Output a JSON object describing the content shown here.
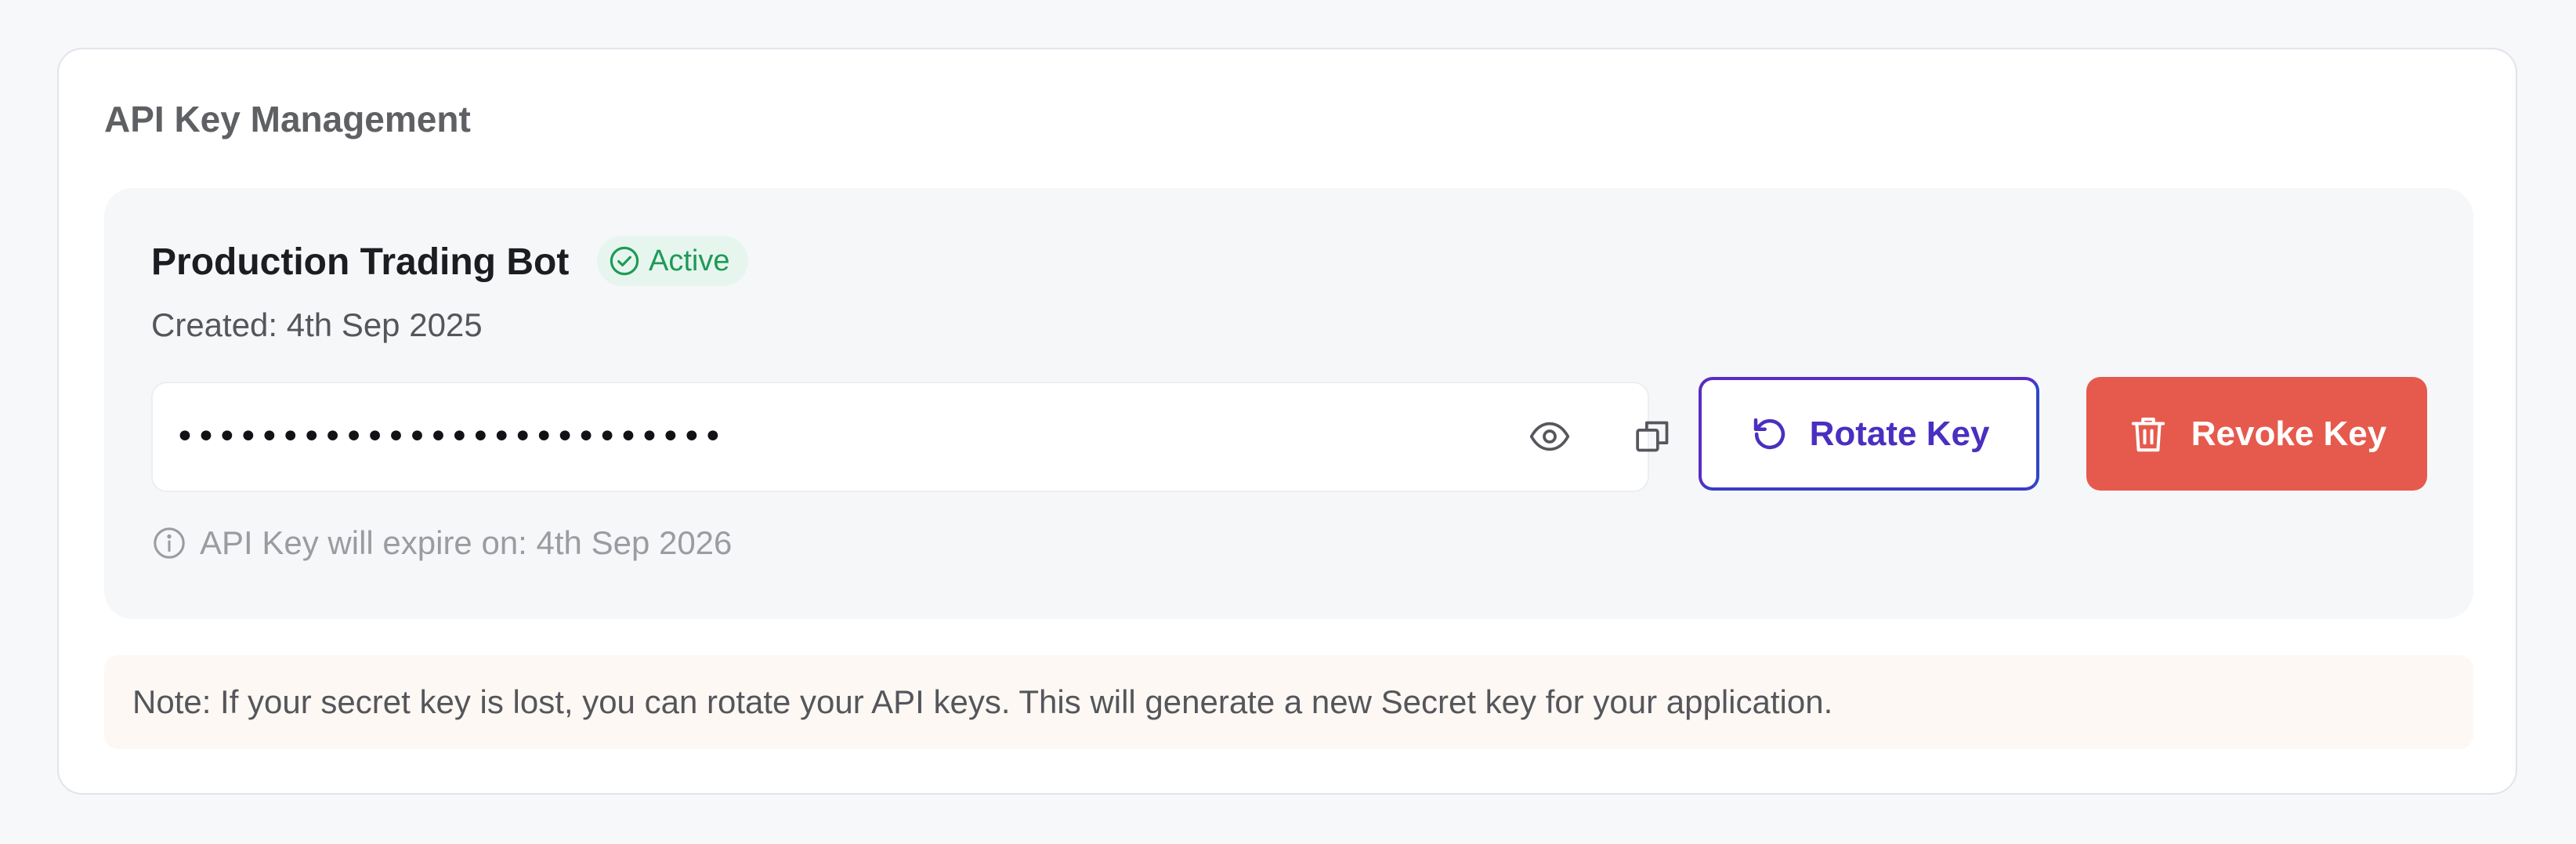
{
  "card": {
    "title": "API Key Management"
  },
  "key": {
    "name": "Production Trading Bot",
    "status": "Active",
    "created": "Created: 4th Sep 2025",
    "masked_value": "••••••••••••••••••••••••••",
    "expiry": "API Key will expire on: 4th Sep 2026"
  },
  "actions": {
    "rotate_label": "Rotate Key",
    "revoke_label": "Revoke Key"
  },
  "note": {
    "text": "Note: If your secret key is lost, you can rotate your API keys. This will generate a new Secret key for your application."
  },
  "icons": {
    "status": "check-circle-icon",
    "reveal": "eye-icon",
    "copy": "copy-icon",
    "rotate": "rotate-icon",
    "revoke": "trash-icon",
    "info": "info-icon"
  },
  "colors": {
    "active": "#1e9a57",
    "active_bg": "#e6f6ee",
    "rotate_start": "#5a2cc2",
    "rotate_end": "#2c47c9",
    "revoke": "#e65a4d",
    "note_bg": "#fdf8f3"
  }
}
